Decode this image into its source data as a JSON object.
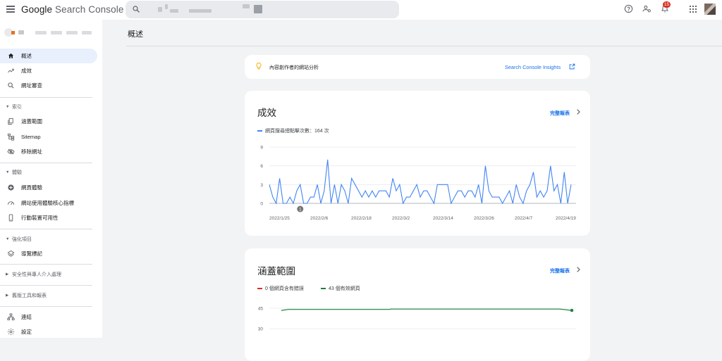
{
  "app": {
    "logo_google": "Google",
    "logo_product": "Search Console",
    "notifications_count": "15"
  },
  "icons": {
    "menu": "menu-icon",
    "search": "search-icon",
    "help": "help-icon",
    "manage_users": "manage-users-icon",
    "notifications": "bell-icon",
    "apps": "apps-grid-icon"
  },
  "sidebar": {
    "items": [
      {
        "label": "概述",
        "icon": "home-icon",
        "active": true
      },
      {
        "label": "成效",
        "icon": "trending-up-icon"
      },
      {
        "label": "網址審查",
        "icon": "search-icon"
      }
    ],
    "sections": [
      {
        "label": "索引",
        "items": [
          {
            "label": "涵蓋範圍",
            "icon": "pages-icon"
          },
          {
            "label": "Sitemap",
            "icon": "sitemap-icon"
          },
          {
            "label": "移除網址",
            "icon": "visibility-off-icon"
          }
        ]
      },
      {
        "label": "體驗",
        "items": [
          {
            "label": "網頁體驗",
            "icon": "add-circle-icon"
          },
          {
            "label": "網站使用體驗核心指標",
            "icon": "speed-icon"
          },
          {
            "label": "行動裝置可用性",
            "icon": "smartphone-icon"
          }
        ]
      },
      {
        "label": "強化項目",
        "items": [
          {
            "label": "導覽標記",
            "icon": "layers-icon"
          }
        ]
      }
    ],
    "collapsed_sections": [
      {
        "label": "安全性與專人介入處理"
      },
      {
        "label": "舊版工具和報表"
      }
    ],
    "bottom_items": [
      {
        "label": "連結",
        "icon": "links-icon"
      },
      {
        "label": "設定",
        "icon": "settings-icon"
      }
    ]
  },
  "main": {
    "page_title": "概述",
    "insights": {
      "text": "內容創作者的網站分析",
      "link": "Search Console Insights"
    },
    "performance": {
      "title": "成效",
      "full_report": "完整報表",
      "legend": "網頁搜尋總點擊次數：164 次"
    },
    "coverage": {
      "title": "涵蓋範圍",
      "full_report": "完整報表",
      "legend_error": "0 個網頁含有錯誤",
      "legend_valid": "43 個有效網頁"
    }
  },
  "colors": {
    "accent": "#1a73e8",
    "clicks_line": "#4285f4",
    "valid_line": "#188038",
    "error": "#d93025",
    "active_nav": "#e8f0fe"
  },
  "chart_data": [
    {
      "type": "line",
      "series": [
        {
          "name": "網頁搜尋總點擊次數",
          "values": [
            3,
            1,
            0,
            4,
            0,
            0,
            1,
            0,
            2,
            3,
            0,
            0,
            1,
            1,
            3,
            0,
            2,
            7,
            0,
            3,
            0,
            3,
            2,
            0,
            4,
            3,
            2,
            1,
            2,
            1,
            2,
            1,
            2,
            2,
            2,
            1,
            4,
            2,
            3,
            0,
            1,
            1,
            2,
            3,
            1,
            2,
            2,
            1,
            0,
            3,
            3,
            3,
            3,
            0,
            1,
            2,
            2,
            1,
            2,
            2,
            1,
            3,
            0,
            6,
            2,
            1,
            1,
            1,
            0,
            1,
            2,
            0,
            3,
            1,
            0,
            2,
            3,
            5,
            1,
            2,
            1,
            2,
            6,
            2,
            3,
            0,
            5,
            0,
            3
          ]
        }
      ],
      "x_ticks": [
        "2022/1/25",
        "2022/2/6",
        "2022/2/18",
        "2022/3/2",
        "2022/3/14",
        "2022/3/26",
        "2022/4/7",
        "2022/4/19"
      ],
      "y_ticks": [
        "9",
        "6",
        "3",
        "0"
      ],
      "ylim": [
        0,
        9
      ],
      "annotation_marker": "1",
      "grid": true
    },
    {
      "type": "line",
      "series": [
        {
          "name": "0 個網頁含有錯誤",
          "values": [
            0
          ]
        },
        {
          "name": "43 個有效網頁",
          "values": [
            43,
            44,
            44,
            44,
            44,
            44,
            44,
            44,
            44,
            44,
            44,
            44,
            44,
            44,
            44,
            44,
            44,
            44,
            44,
            44,
            44,
            44,
            44,
            44,
            44,
            44,
            44,
            44,
            44,
            44,
            44,
            44,
            44,
            44,
            44,
            44,
            44,
            44,
            44,
            44,
            44,
            44,
            44,
            44,
            44,
            44,
            44,
            44,
            44,
            44,
            44,
            44,
            44,
            44,
            44,
            44,
            44,
            44,
            44,
            44,
            44,
            44,
            43
          ]
        }
      ],
      "y_ticks": [
        "45",
        "30"
      ],
      "grid": true
    }
  ]
}
